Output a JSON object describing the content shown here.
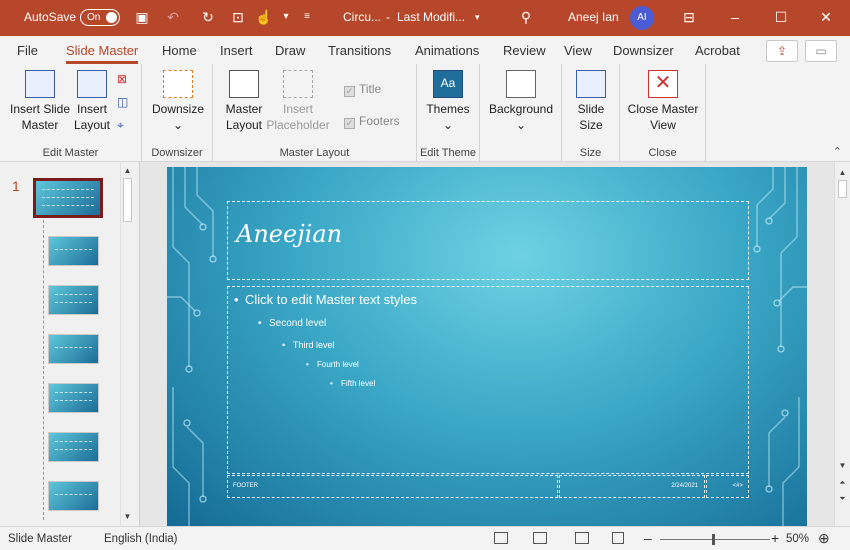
{
  "titlebar": {
    "autosave_label": "AutoSave",
    "autosave_state": "On",
    "filename": "Circu...",
    "separator": "-",
    "modified": "Last Modifi...",
    "user": "Aneej Ian",
    "user_initials": "AI",
    "accent": "#b7472a"
  },
  "tabs": [
    "File",
    "Slide Master",
    "Home",
    "Insert",
    "Draw",
    "Transitions",
    "Animations",
    "Review",
    "View",
    "Downsizer",
    "Acrobat"
  ],
  "ribbon": {
    "insert_slide_master": "Insert Slide Master",
    "insert_layout": "Insert Layout",
    "group_edit_master": "Edit Master",
    "downsize": "Downsize",
    "group_downsizer": "Downsizer",
    "master_layout": "Master Layout",
    "insert_placeholder": "Insert Placeholder",
    "title_cb": "Title",
    "footers_cb": "Footers",
    "group_master_layout": "Master Layout",
    "themes": "Themes",
    "group_edit_theme": "Edit Theme",
    "background": "Background",
    "slide_size": "Slide Size",
    "group_size": "Size",
    "close_master_view": "Close Master View",
    "group_close": "Close"
  },
  "thumbs": {
    "slide_number": "1"
  },
  "slide": {
    "title": "Aneejian",
    "level1": "Click to edit Master text styles",
    "level2": "Second level",
    "level3": "Third level",
    "level4": "Fourth level",
    "level5": "Fifth level",
    "footer": "FOOTER",
    "date": "2/24/2021",
    "number": "<#>"
  },
  "status": {
    "view": "Slide Master",
    "language": "English (India)",
    "zoom": "50%"
  }
}
